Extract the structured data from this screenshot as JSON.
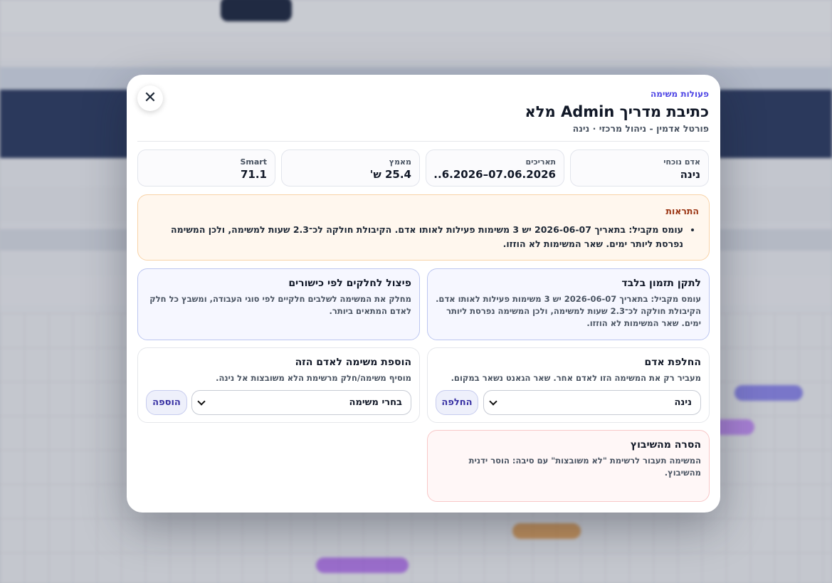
{
  "modal": {
    "kicker": "פעולות משימה",
    "title": "כתיבת מדריך Admin מלא",
    "subtitle": "פורטל אדמין - ניהול מרכזי · נינה",
    "close_icon": "close-icon"
  },
  "stats": [
    {
      "label": "אדם נוכחי",
      "value": "נינה"
    },
    {
      "label": "תאריכים",
      "value": "07.06.2026–6.2026..."
    },
    {
      "label": "מאמץ",
      "value": "25.4 ש'"
    },
    {
      "label": "Smart",
      "value": "71.1"
    }
  ],
  "alerts": {
    "heading": "התראות",
    "items": [
      "עומס מקביל: בתאריך 2026-06-07 יש 3 משימות פעילות לאותו אדם. הקיבולת חולקה לכ־2.3 שעות למשימה, ולכן המשימה נפרסת ליותר ימים. שאר המשימות לא הוזזו."
    ]
  },
  "cards": {
    "fix_timing": {
      "title": "לתקן תזמון בלבד",
      "desc": "עומס מקביל: בתאריך 2026-06-07 יש 3 משימות פעילות לאותו אדם. הקיבולת חולקה לכ־2.3 שעות למשימה, ולכן המשימה נפרסת ליותר ימים. שאר המשימות לא הוזזו."
    },
    "split": {
      "title": "פיצול לחלקים לפי כישורים",
      "desc": "מחלק את המשימה לשלבים חלקיים לפי סוגי העבודה, ומשבץ כל חלק לאדם המתאים ביותר."
    },
    "replace_person": {
      "title": "החלפת אדם",
      "desc": "מעביר רק את המשימה הזו לאדם אחר. שאר הגאנט נשאר במקום.",
      "select_value": "נינה",
      "button": "החלפה"
    },
    "add_task": {
      "title": "הוספת משימה לאדם הזה",
      "desc": "מוסיף משימה/חלק מרשימת הלא משובצות אל נינה.",
      "select_value": "בחרי משימה",
      "button": "הוספה"
    },
    "remove": {
      "title": "הסרה מהשיבוץ",
      "desc": "המשימה תעבור לרשימת \"לא משובצות\" עם סיבה: הוסר ידנית מהשיבוץ."
    }
  },
  "colors": {
    "accent": "#4f46e5",
    "alert_bg": "#fff7ee",
    "alert_heading": "#9a3412",
    "danger_bg": "#fff7f7"
  }
}
